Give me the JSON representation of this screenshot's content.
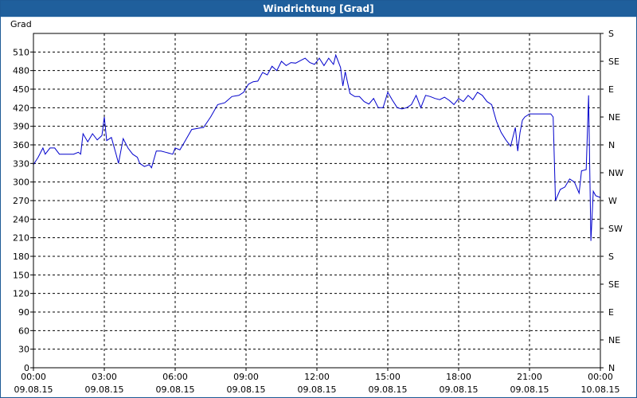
{
  "window": {
    "title": "Windrichtung [Grad]"
  },
  "chart_data": {
    "type": "line",
    "title": "Windrichtung [Grad]",
    "ylabel": "Grad",
    "ylim": [
      0,
      540
    ],
    "yticks": [
      0,
      30,
      60,
      90,
      120,
      150,
      180,
      210,
      240,
      270,
      300,
      330,
      360,
      390,
      420,
      450,
      480,
      510
    ],
    "y2ticks": [
      {
        "v": 0,
        "label": "N"
      },
      {
        "v": 45,
        "label": "NE"
      },
      {
        "v": 90,
        "label": "E"
      },
      {
        "v": 135,
        "label": "SE"
      },
      {
        "v": 180,
        "label": "S"
      },
      {
        "v": 225,
        "label": "SW"
      },
      {
        "v": 270,
        "label": "W"
      },
      {
        "v": 315,
        "label": "NW"
      },
      {
        "v": 360,
        "label": "N"
      },
      {
        "v": 405,
        "label": "NE"
      },
      {
        "v": 450,
        "label": "E"
      },
      {
        "v": 495,
        "label": "SE"
      },
      {
        "v": 540,
        "label": "S"
      }
    ],
    "xlim_hours": [
      0,
      24
    ],
    "xticks": [
      {
        "h": 0,
        "time": "00:00",
        "date": "09.08.15"
      },
      {
        "h": 3,
        "time": "03:00",
        "date": "09.08.15"
      },
      {
        "h": 6,
        "time": "06:00",
        "date": "09.08.15"
      },
      {
        "h": 9,
        "time": "09:00",
        "date": "09.08.15"
      },
      {
        "h": 12,
        "time": "12:00",
        "date": "09.08.15"
      },
      {
        "h": 15,
        "time": "15:00",
        "date": "09.08.15"
      },
      {
        "h": 18,
        "time": "18:00",
        "date": "09.08.15"
      },
      {
        "h": 21,
        "time": "21:00",
        "date": "09.08.15"
      },
      {
        "h": 24,
        "time": "00:00",
        "date": "10.08.15"
      }
    ],
    "grid": true,
    "line_color": "#0000cc",
    "series": [
      {
        "x": [
          0,
          0.2,
          0.4,
          0.5,
          0.7,
          0.9,
          1.1,
          1.4,
          1.7,
          1.9,
          2.0,
          2.1,
          2.3,
          2.5,
          2.7,
          2.9,
          3.0,
          3.1,
          3.3,
          3.5,
          3.6,
          3.8,
          4.0,
          4.2,
          4.4,
          4.5,
          4.7,
          4.9,
          5.0,
          5.2,
          5.4,
          5.6,
          5.7,
          5.9,
          6.0,
          6.2,
          6.4,
          6.7,
          7.0,
          7.2,
          7.5,
          7.8,
          8.1,
          8.4,
          8.7,
          8.9,
          9.1,
          9.3,
          9.5,
          9.7,
          9.9,
          10.1,
          10.3,
          10.5,
          10.7,
          10.9,
          11.1,
          11.3,
          11.5,
          11.7,
          11.9,
          12.1,
          12.3,
          12.5,
          12.7,
          12.8,
          13.0,
          13.1,
          13.2,
          13.4,
          13.6,
          13.8,
          14.0,
          14.2,
          14.4,
          14.6,
          14.8,
          15.0,
          15.2,
          15.4,
          15.6,
          15.8,
          16.0,
          16.2,
          16.4,
          16.6,
          16.8,
          17.0,
          17.2,
          17.4,
          17.6,
          17.8,
          18.0,
          18.2,
          18.4,
          18.6,
          18.8,
          19.0,
          19.2,
          19.4,
          19.6,
          19.8,
          20.0,
          20.2,
          20.4,
          20.5,
          20.6,
          20.7,
          20.8,
          21.0,
          21.3,
          21.6,
          21.9,
          22.0,
          22.1,
          22.3,
          22.5,
          22.7,
          22.9,
          23.1,
          23.2,
          23.4,
          23.5,
          23.6,
          23.7,
          23.8,
          24.0
        ],
        "y": [
          328,
          340,
          355,
          345,
          355,
          355,
          345,
          345,
          345,
          348,
          345,
          378,
          365,
          378,
          368,
          375,
          405,
          367,
          372,
          345,
          330,
          370,
          355,
          345,
          340,
          330,
          325,
          328,
          323,
          350,
          350,
          348,
          347,
          345,
          355,
          352,
          365,
          385,
          387,
          388,
          405,
          425,
          428,
          438,
          440,
          445,
          458,
          462,
          463,
          477,
          473,
          487,
          480,
          495,
          488,
          493,
          492,
          496,
          500,
          493,
          490,
          500,
          488,
          500,
          490,
          505,
          485,
          455,
          478,
          443,
          438,
          438,
          430,
          426,
          435,
          420,
          420,
          445,
          432,
          420,
          418,
          420,
          425,
          440,
          420,
          440,
          438,
          435,
          433,
          437,
          432,
          425,
          435,
          430,
          440,
          433,
          445,
          440,
          430,
          425,
          398,
          380,
          368,
          358,
          388,
          350,
          380,
          400,
          405,
          410,
          410,
          410,
          410,
          405,
          270,
          288,
          292,
          305,
          300,
          282,
          318,
          320,
          440,
          205,
          285,
          278,
          275
        ]
      }
    ]
  }
}
